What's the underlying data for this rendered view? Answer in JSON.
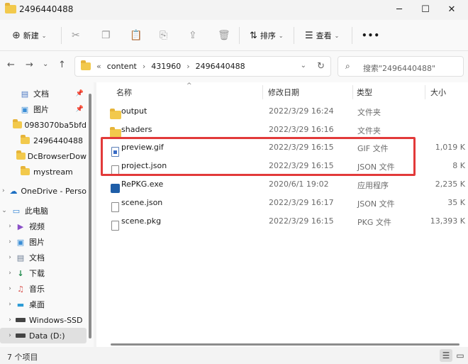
{
  "window": {
    "title": "2496440488",
    "minimize": "─",
    "maximize": "☐",
    "close": "✕"
  },
  "toolbar": {
    "new_icon": "⊕",
    "new_label": "新建",
    "cut_icon": "✂",
    "copy_icon": "❐",
    "paste_icon": "📋",
    "rename_icon": "⎘",
    "share_icon": "⇪",
    "delete_icon": "🗑",
    "sort_icon": "⇅",
    "sort_label": "排序",
    "view_icon": "☰",
    "view_label": "查看",
    "more_icon": "•••"
  },
  "nav": {
    "back": "←",
    "forward": "→",
    "dropdown": "⌄",
    "up": "↑",
    "crumb_prefix": "«",
    "path": [
      "content",
      "431960",
      "2496440488"
    ],
    "separator": "›",
    "refresh": "↻",
    "search_icon": "⌕",
    "search_placeholder": "搜索\"2496440488\""
  },
  "sidebar": {
    "quick_access": [
      {
        "label": "文档",
        "icon": "document-icon",
        "glyph": "▤",
        "pinned": true
      },
      {
        "label": "图片",
        "icon": "pictures-icon",
        "glyph": "▣",
        "pinned": true
      },
      {
        "label": "0983070ba5bfd",
        "icon": "folder-icon",
        "pinned": false
      },
      {
        "label": "2496440488",
        "icon": "folder-icon",
        "pinned": false
      },
      {
        "label": "DcBrowserDow",
        "icon": "folder-icon",
        "pinned": false
      },
      {
        "label": "mystream",
        "icon": "folder-icon",
        "pinned": false
      }
    ],
    "onedrive": {
      "label": "OneDrive - Perso",
      "icon": "cloud-icon",
      "glyph": "☁"
    },
    "this_pc": {
      "label": "此电脑",
      "icon": "computer-icon",
      "glyph": "▭"
    },
    "pc_items": [
      {
        "label": "视频",
        "icon": "video-icon",
        "glyph": "▶"
      },
      {
        "label": "图片",
        "icon": "pictures-icon",
        "glyph": "▣"
      },
      {
        "label": "文档",
        "icon": "document-icon",
        "glyph": "▤"
      },
      {
        "label": "下载",
        "icon": "download-icon",
        "glyph": "↓"
      },
      {
        "label": "音乐",
        "icon": "music-icon",
        "glyph": "♫"
      },
      {
        "label": "桌面",
        "icon": "desktop-icon",
        "glyph": "▬"
      },
      {
        "label": "Windows-SSD",
        "icon": "drive-icon",
        "glyph": ""
      },
      {
        "label": "Data (D:)",
        "icon": "drive-icon",
        "glyph": "",
        "selected": true
      }
    ],
    "pin_glyph": "📌",
    "expand_glyph": "›",
    "open_glyph": "⌄"
  },
  "columns": {
    "name": "名称",
    "modified": "修改日期",
    "type": "类型",
    "size": "大小",
    "sort_glyph": "^"
  },
  "files": [
    {
      "name": "output",
      "kind": "folder",
      "modified": "2022/3/29 16:24",
      "type": "文件夹",
      "size": ""
    },
    {
      "name": "shaders",
      "kind": "folder",
      "modified": "2022/3/29 16:16",
      "type": "文件夹",
      "size": ""
    },
    {
      "name": "preview.gif",
      "kind": "gif",
      "modified": "2022/3/29 16:15",
      "type": "GIF 文件",
      "size": "1,019 K"
    },
    {
      "name": "project.json",
      "kind": "file",
      "modified": "2022/3/29 16:15",
      "type": "JSON 文件",
      "size": "8 K"
    },
    {
      "name": "RePKG.exe",
      "kind": "exe",
      "modified": "2020/6/1 19:02",
      "type": "应用程序",
      "size": "2,235 K"
    },
    {
      "name": "scene.json",
      "kind": "file",
      "modified": "2022/3/29 16:17",
      "type": "JSON 文件",
      "size": "35 K"
    },
    {
      "name": "scene.pkg",
      "kind": "file",
      "modified": "2022/3/29 16:15",
      "type": "PKG 文件",
      "size": "13,393 K"
    }
  ],
  "status": {
    "item_count": "7 个项目",
    "details_view_icon": "☰",
    "tiles_view_icon": "▭"
  },
  "colors": {
    "highlight": "#e23a3a",
    "folder": "#f2c94c"
  }
}
